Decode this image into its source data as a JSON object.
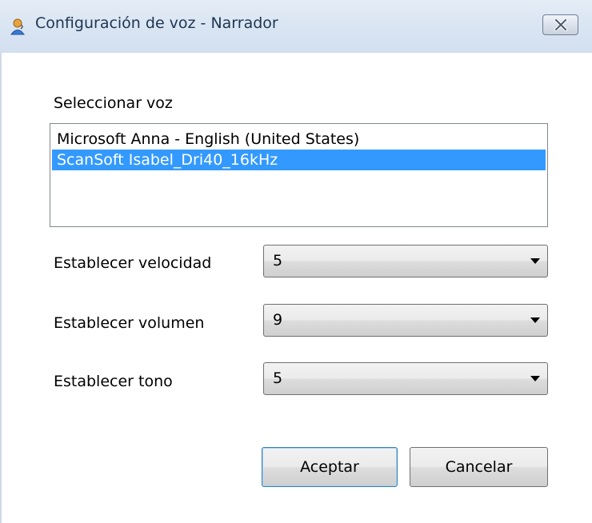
{
  "window": {
    "title": "Configuración de voz - Narrador",
    "icon": "narrator-icon",
    "close_icon": "close-icon"
  },
  "voice": {
    "label": "Seleccionar voz",
    "options": [
      "Microsoft Anna - English (United States)",
      "ScanSoft Isabel_Dri40_16kHz"
    ],
    "selected_index": 1
  },
  "speed": {
    "label": "Establecer velocidad",
    "value": "5"
  },
  "volume": {
    "label": "Establecer volumen",
    "value": "9"
  },
  "pitch": {
    "label": "Establecer tono",
    "value": "5"
  },
  "buttons": {
    "ok": "Aceptar",
    "cancel": "Cancelar"
  },
  "colors": {
    "selection": "#3399ff",
    "titlebar": "#dbe6f3",
    "title_text": "#1f3551"
  }
}
